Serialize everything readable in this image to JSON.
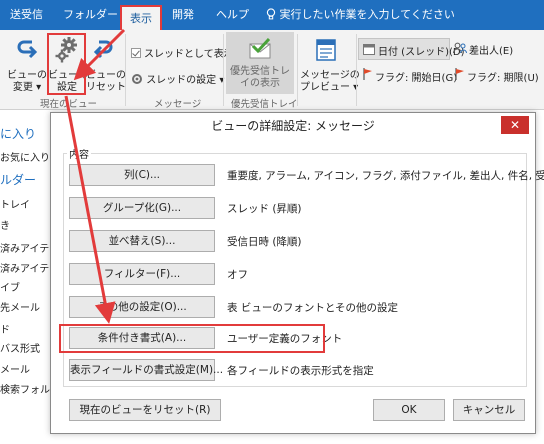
{
  "ribbon": {
    "tabs": [
      "送受信",
      "フォルダー",
      "表示",
      "開発",
      "ヘルプ"
    ],
    "active_tab": "表示",
    "tell_me": "実行したい作業を入力してください",
    "buttons": {
      "view_change": [
        "ビューの",
        "変更 ▾"
      ],
      "view_settings": [
        "ビューの",
        "設定"
      ],
      "view_reset": [
        "ビューの",
        "リセット"
      ],
      "priority_inbox": [
        "優先受信トレ",
        "イの表示"
      ],
      "message_preview": [
        "メッセージの",
        "プレビュー ▾"
      ]
    },
    "small": {
      "show_as_thread": "スレッドとして表示",
      "thread_settings": "スレッドの設定 ▾",
      "date_thread": "日付 (スレッド)(D)",
      "sender": "差出人(E)",
      "flag_start": "フラグ: 開始日(G)",
      "flag_due": "フラグ: 期限(U)"
    },
    "groups": {
      "current_view": "現在のビュー",
      "message": "メッセージ",
      "priority": "優先受信トレイ"
    }
  },
  "leftnav": [
    "に入り",
    "お気に入り",
    "ルダー",
    "トレイ",
    "き",
    "済みアイテ",
    "済みアイテ",
    "イブ",
    "先メール",
    "ド",
    "バス形式",
    "メール",
    "検索フォルダ"
  ],
  "dialog": {
    "title": "ビューの詳細設定: メッセージ",
    "close_glyph": "✕",
    "group_label": "内容",
    "rows": [
      {
        "button": "列(C)...",
        "value": "重要度, アラーム, アイコン, フラグ, 添付ファイル, 差出人, 件名, 受信..."
      },
      {
        "button": "グループ化(G)...",
        "value": "スレッド (昇順)"
      },
      {
        "button": "並べ替え(S)...",
        "value": "受信日時 (降順)"
      },
      {
        "button": "フィルター(F)...",
        "value": "オフ"
      },
      {
        "button": "その他の設定(O)...",
        "value": "表 ビューのフォントとその他の設定"
      },
      {
        "button": "条件付き書式(A)...",
        "value": "ユーザー定義のフォント"
      },
      {
        "button": "表示フィールドの書式設定(M)...",
        "value": "各フィールドの表示形式を指定"
      }
    ],
    "reset_button": "現在のビューをリセット(R)",
    "ok_button": "OK",
    "cancel_button": "キャンセル"
  },
  "colors": {
    "ribbon_blue": "#1f6fbf",
    "highlight_red": "#e23b3b",
    "close_red": "#c9302c"
  }
}
